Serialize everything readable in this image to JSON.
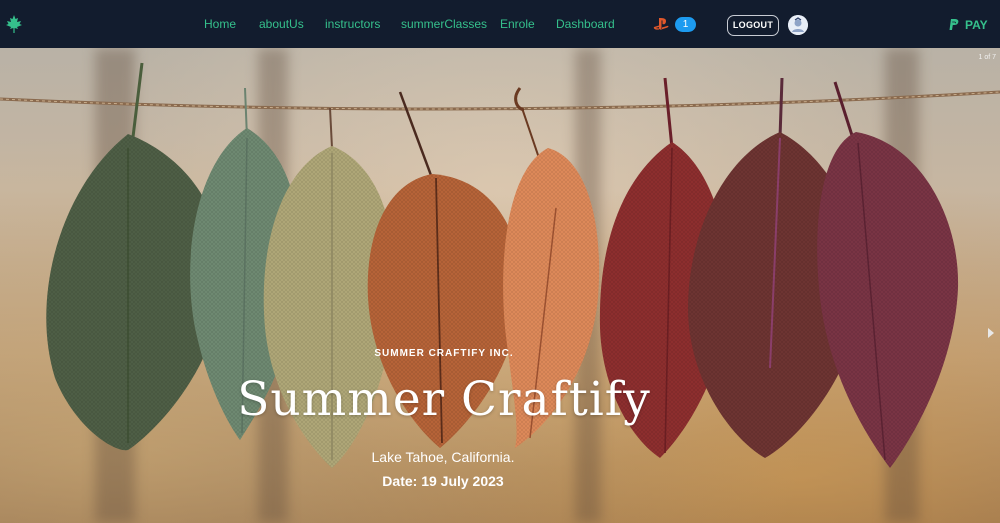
{
  "nav": {
    "brand_icon": "maple-leaf-icon",
    "links": [
      {
        "label": "Home"
      },
      {
        "label": "aboutUs"
      },
      {
        "label": "instructors"
      },
      {
        "label": "summerClasses"
      },
      {
        "label": "Enrole"
      },
      {
        "label": "Dashboard"
      }
    ],
    "cart_icon": "playstation-icon",
    "cart_count": "1",
    "logout_label": "LOGOUT",
    "avatar_icon": "user-avatar",
    "pay_icon": "paypal-icon",
    "pay_label": "PAY"
  },
  "hero": {
    "slide_counter": "1 of 7",
    "next_icon": "chevron-right-icon",
    "subtitle": "SUMMER CRAFTIFY INC.",
    "title": "Summer Craftify",
    "location": "Lake Tahoe, California.",
    "date": "Date: 19 July 2023"
  },
  "colors": {
    "navbar_bg": "#121c2e",
    "accent_green": "#35c08c",
    "badge_blue": "#1d9bf0",
    "leaf_colors": [
      "#4f5f46",
      "#6f8a72",
      "#b0a878",
      "#b76438",
      "#df8a5a",
      "#8e2f2f",
      "#6e3432",
      "#7a3445"
    ]
  }
}
